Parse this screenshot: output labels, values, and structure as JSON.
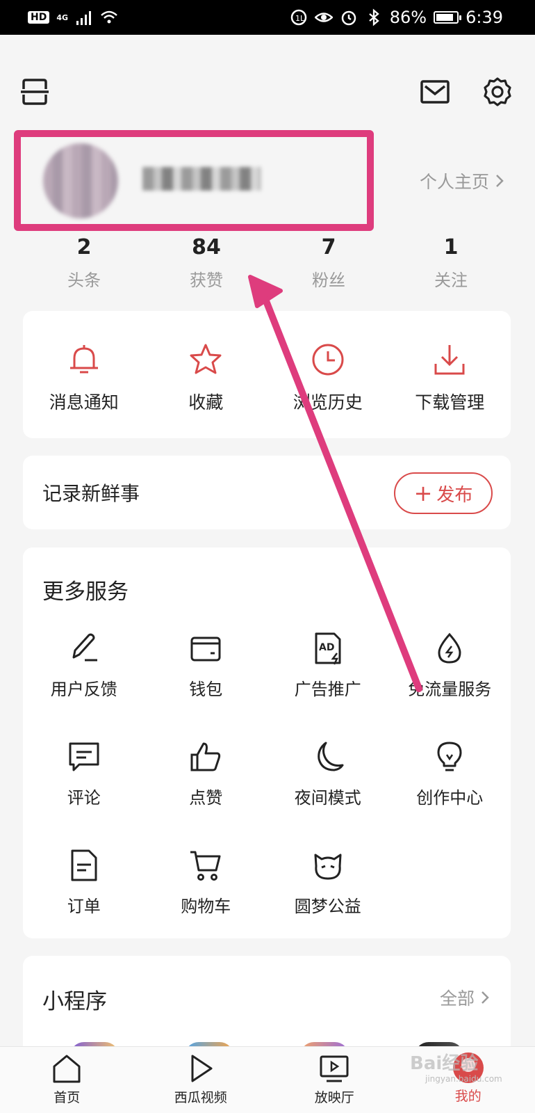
{
  "status_bar": {
    "hd": "HD",
    "network": "4G",
    "battery_percent": "86%",
    "battery_level": 0.86,
    "time": "6:39"
  },
  "header": {
    "menu_icon": "scan-frame-icon",
    "mail_icon": "mail-icon",
    "settings_icon": "gear-icon"
  },
  "profile": {
    "homepage_label": "个人主页"
  },
  "stats": [
    {
      "value": "2",
      "label": "头条"
    },
    {
      "value": "84",
      "label": "获赞"
    },
    {
      "value": "7",
      "label": "粉丝"
    },
    {
      "value": "1",
      "label": "关注"
    }
  ],
  "quick_actions": [
    {
      "label": "消息通知",
      "icon": "bell-icon"
    },
    {
      "label": "收藏",
      "icon": "star-icon"
    },
    {
      "label": "浏览历史",
      "icon": "clock-icon"
    },
    {
      "label": "下载管理",
      "icon": "download-icon"
    }
  ],
  "post": {
    "title": "记录新鲜事",
    "button_label": "发布"
  },
  "services": {
    "title": "更多服务",
    "items": [
      {
        "label": "用户反馈",
        "icon": "pen-icon"
      },
      {
        "label": "钱包",
        "icon": "wallet-icon"
      },
      {
        "label": "广告推广",
        "icon": "ad-icon"
      },
      {
        "label": "免流量服务",
        "icon": "drop-icon"
      },
      {
        "label": "评论",
        "icon": "comment-icon"
      },
      {
        "label": "点赞",
        "icon": "thumbs-up-icon"
      },
      {
        "label": "夜间模式",
        "icon": "moon-icon"
      },
      {
        "label": "创作中心",
        "icon": "lightbulb-icon"
      },
      {
        "label": "订单",
        "icon": "order-icon"
      },
      {
        "label": "购物车",
        "icon": "cart-icon"
      },
      {
        "label": "圆梦公益",
        "icon": "charity-icon"
      }
    ]
  },
  "mini_programs": {
    "title": "小程序",
    "all_label": "全部"
  },
  "tabbar": [
    {
      "label": "首页",
      "icon": "home-icon"
    },
    {
      "label": "西瓜视频",
      "icon": "play-icon"
    },
    {
      "label": "放映厅",
      "icon": "tv-icon"
    },
    {
      "label": "我的",
      "icon": "profile-icon",
      "active": true
    }
  ],
  "watermark": {
    "text": "Bai经验",
    "sub": "jingyan.baidu.com"
  },
  "colors": {
    "accent": "#d94a4a",
    "highlight": "#de3c7d"
  }
}
